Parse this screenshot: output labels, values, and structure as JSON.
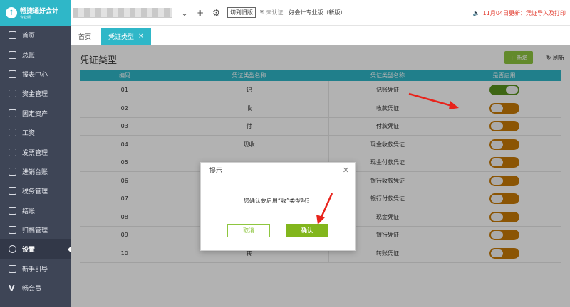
{
  "logo": {
    "title": "畅捷通好会计",
    "subtitle": "专业版"
  },
  "sidebar": {
    "items": [
      {
        "label": "首页",
        "icon": "home-icon"
      },
      {
        "label": "总账",
        "icon": "ledger-icon"
      },
      {
        "label": "报表中心",
        "icon": "chart-icon"
      },
      {
        "label": "资金管理",
        "icon": "money-icon"
      },
      {
        "label": "固定资产",
        "icon": "asset-icon"
      },
      {
        "label": "工资",
        "icon": "salary-icon"
      },
      {
        "label": "发票管理",
        "icon": "invoice-icon"
      },
      {
        "label": "进销台账",
        "icon": "inventory-icon"
      },
      {
        "label": "税务管理",
        "icon": "tax-icon"
      },
      {
        "label": "结账",
        "icon": "close-books-icon"
      },
      {
        "label": "归档管理",
        "icon": "archive-icon"
      },
      {
        "label": "设置",
        "icon": "gear-icon",
        "active": true
      },
      {
        "label": "新手引导",
        "icon": "guide-icon"
      },
      {
        "label": "畅会员",
        "icon": "vip-icon"
      }
    ]
  },
  "topbar": {
    "add_icon": "+",
    "switch_label": "切到旧版",
    "cert_label": "未认证",
    "edition": "好会计专业版（新版）",
    "notice": "11月04日更新：凭证导入及打印"
  },
  "tabs": [
    {
      "label": "首页"
    },
    {
      "label": "凭证类型",
      "active": true
    }
  ],
  "page": {
    "title": "凭证类型",
    "add_label": "+ 新增",
    "refresh_label": "刷新"
  },
  "table": {
    "headers": [
      "编码",
      "凭证类型名称",
      "凭证类型名称",
      "是否启用"
    ],
    "rows": [
      {
        "code": "01",
        "short": "记",
        "name": "记账凭证",
        "enabled": true
      },
      {
        "code": "02",
        "short": "收",
        "name": "收款凭证",
        "enabled": false
      },
      {
        "code": "03",
        "short": "付",
        "name": "付款凭证",
        "enabled": false
      },
      {
        "code": "04",
        "short": "现收",
        "name": "现金收款凭证",
        "enabled": false
      },
      {
        "code": "05",
        "short": "",
        "name": "现金付款凭证",
        "enabled": false
      },
      {
        "code": "06",
        "short": "",
        "name": "银行收款凭证",
        "enabled": false
      },
      {
        "code": "07",
        "short": "",
        "name": "银行付款凭证",
        "enabled": false
      },
      {
        "code": "08",
        "short": "",
        "name": "现金凭证",
        "enabled": false
      },
      {
        "code": "09",
        "short": "",
        "name": "银行凭证",
        "enabled": false
      },
      {
        "code": "10",
        "short": "转",
        "name": "转账凭证",
        "enabled": false
      }
    ]
  },
  "dialog": {
    "title": "提示",
    "message": "您确认要启用“收”类型吗？",
    "cancel_label": "取消",
    "confirm_label": "确认"
  },
  "colors": {
    "accent": "#2fb7c8",
    "sidebar": "#3e4556",
    "toggle_off": "#c77a06",
    "toggle_on": "#59921d",
    "confirm": "#82b61d",
    "annotation_arrow": "#e8231b"
  }
}
